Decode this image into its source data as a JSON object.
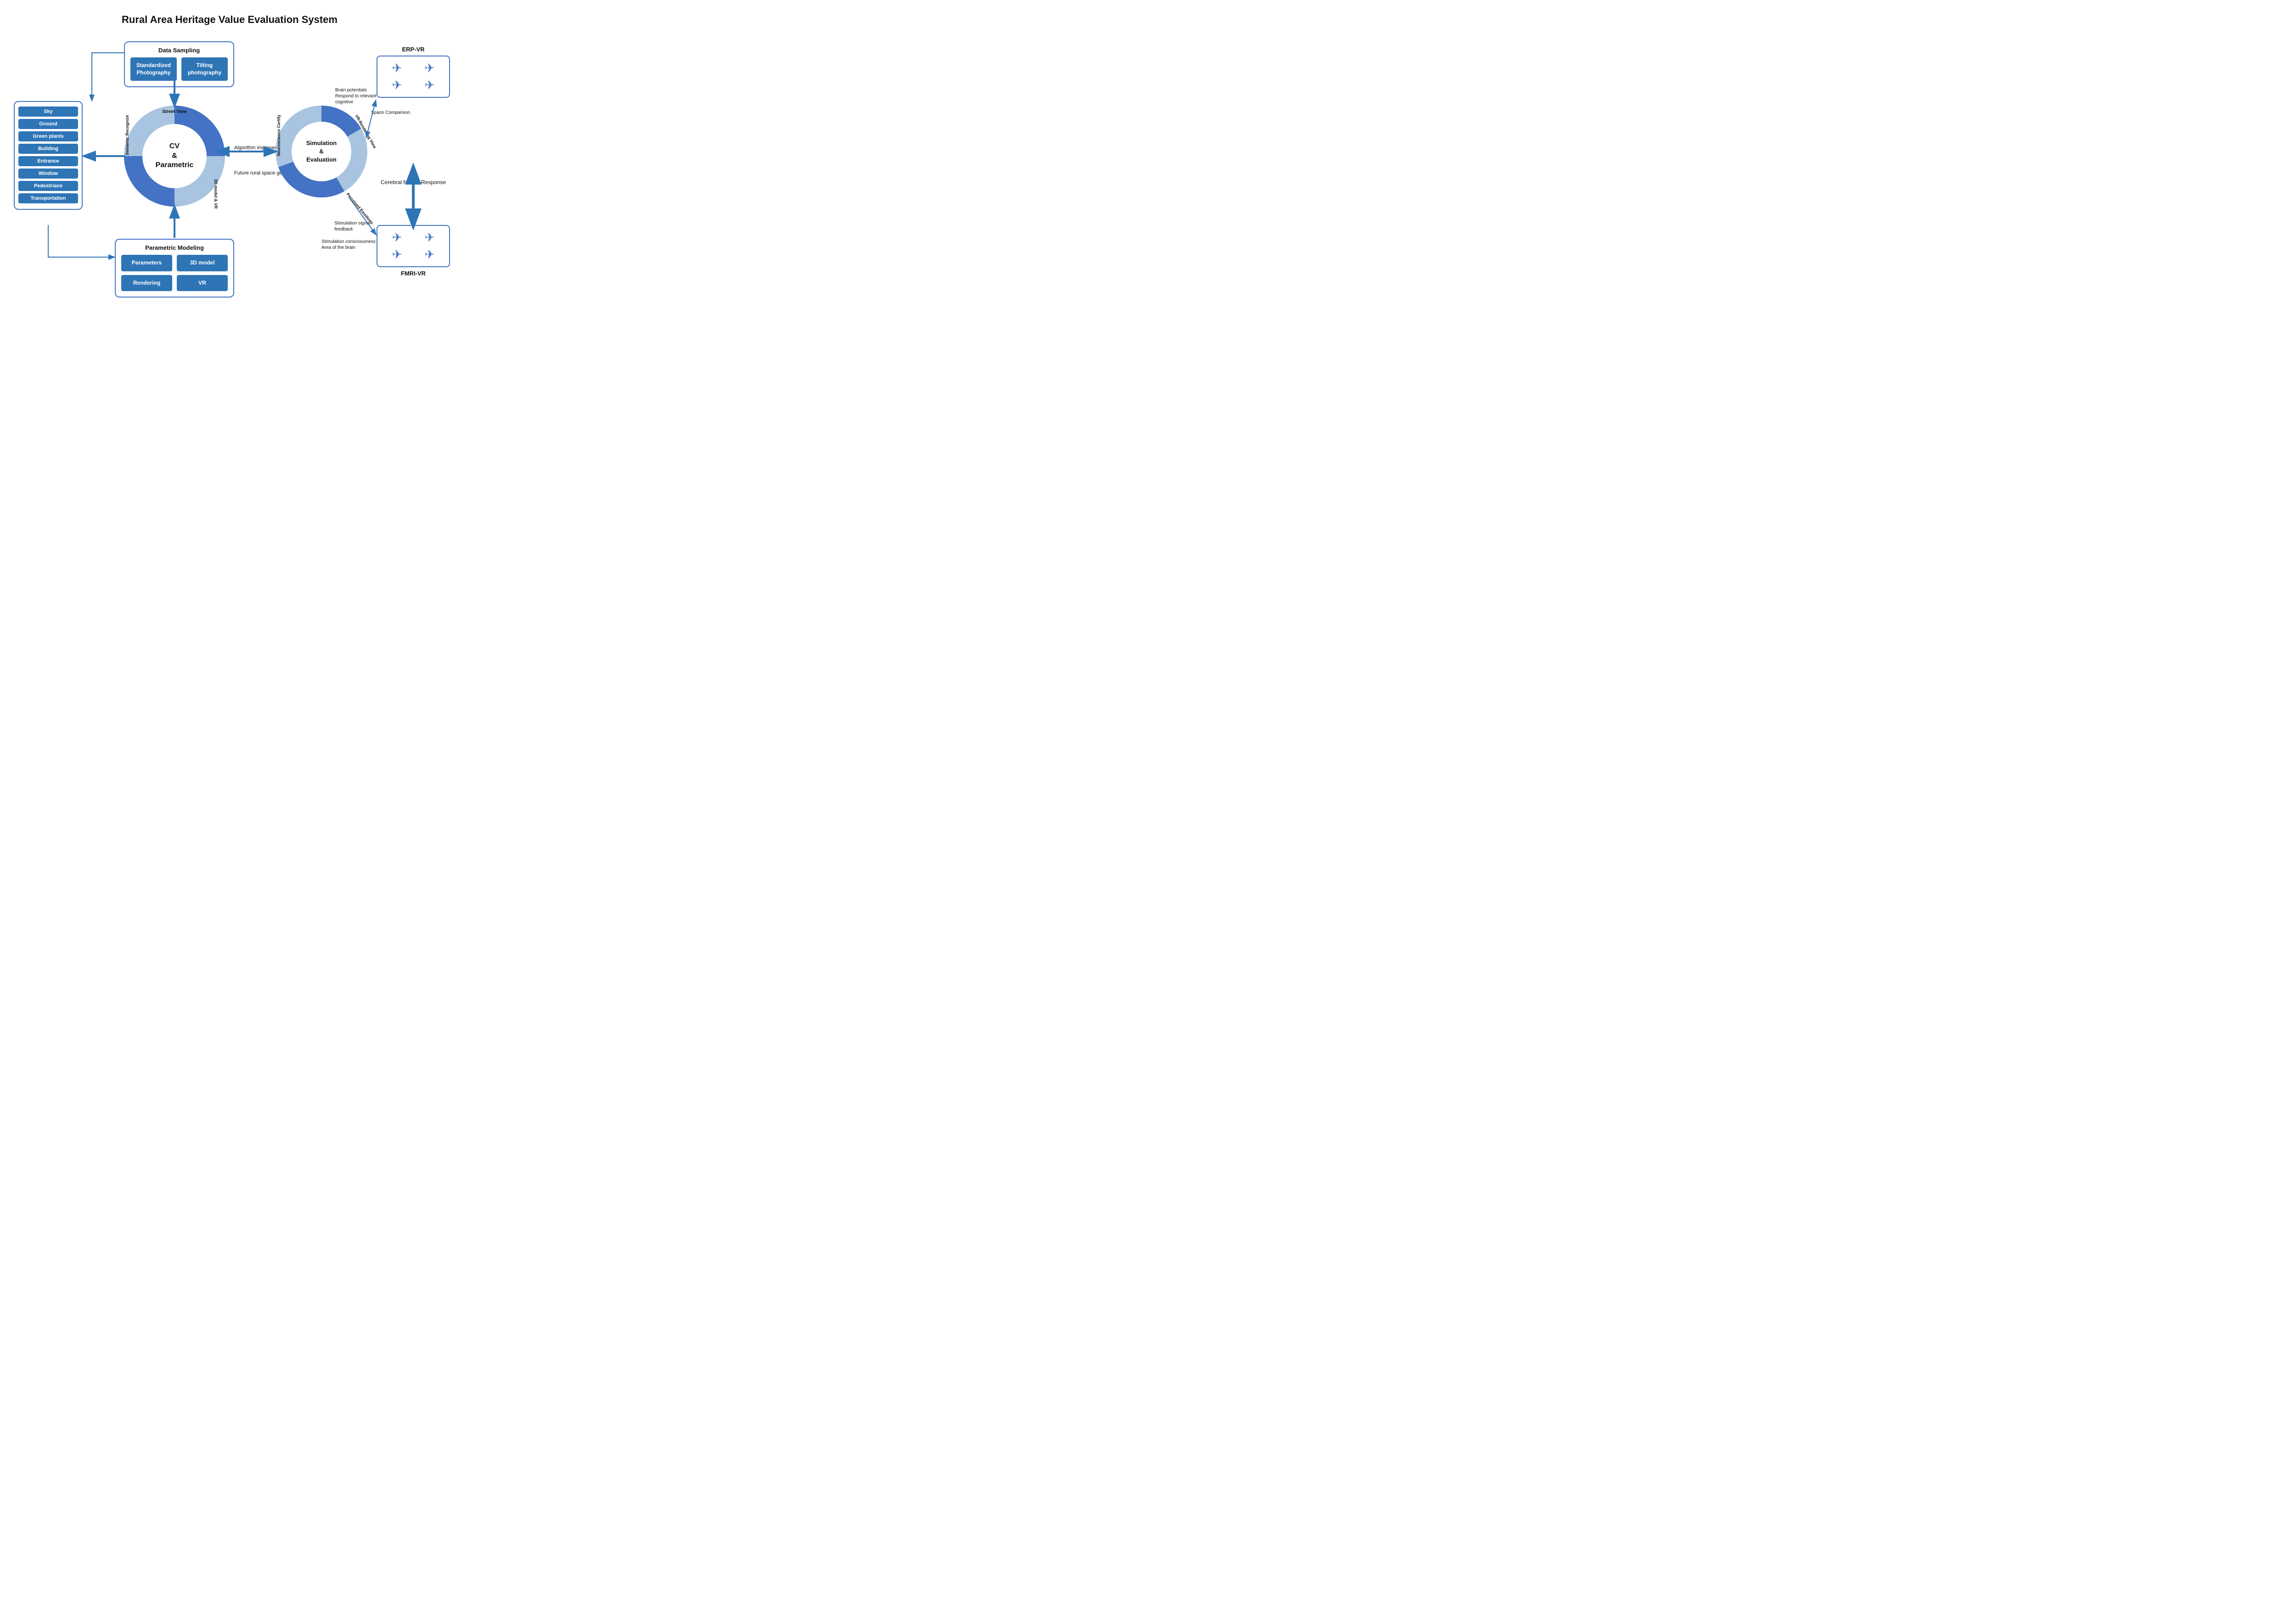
{
  "title": "Rural Area Heritage Value Evaluation System",
  "dataSampling": {
    "label": "Data Sampling",
    "btn1": "Standardized Photography",
    "btn2": "Tilting photography"
  },
  "semanticList": {
    "items": [
      "Sky",
      "Ground",
      "Green plants",
      "Building",
      "Entrance",
      "Window",
      "Pedestrians",
      "Transportation"
    ]
  },
  "cvCircle": {
    "center1": "CV",
    "center2": "&",
    "center3": "Parametric",
    "labelStreet": "Street View",
    "label3d": "3D model & VR",
    "labelSemantic": "Semantic Recognize"
  },
  "arrows": {
    "algorithm": "Algorithm improvement",
    "futureRural": "Future rural space generation"
  },
  "simCircle": {
    "center1": "Simulation",
    "center2": "&",
    "center3": "Evaluation",
    "labelVR": "VR-Rendering View",
    "labelNeuro": "Neuroscience Certify",
    "labelPerceived": "Perceived Emotions"
  },
  "parametricModeling": {
    "label": "Parametric Modeling",
    "btn1": "Parameters",
    "btn2": "3D model",
    "btn3": "Rendering",
    "btn4": "VR"
  },
  "erpVR": {
    "label": "ERP-VR",
    "brainLabel": "Brain potentials Respond to relevant cognitive",
    "spaceLabel": "Space Comparison"
  },
  "fmriVR": {
    "label": "FMRI-VR",
    "stimLabel1": "Stimulation signal feedback",
    "stimLabel2": "Stimulation consciousness Area of the brain"
  },
  "cerebral": {
    "label": "Cerebral Neural Response"
  }
}
